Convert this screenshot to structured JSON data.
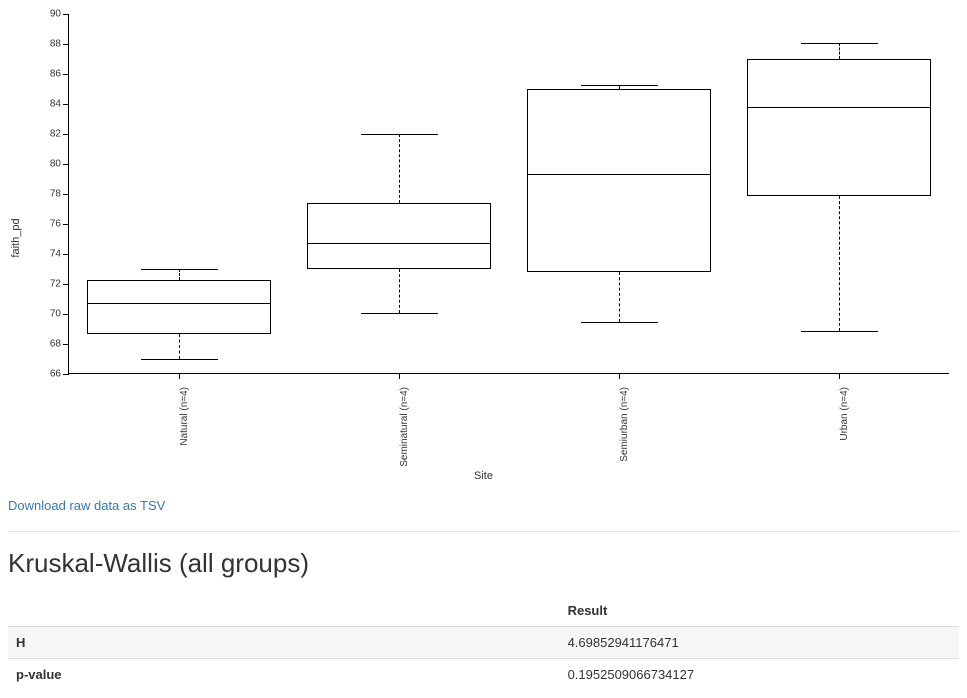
{
  "chart_data": {
    "type": "boxplot",
    "title": "",
    "xlabel": "Site",
    "ylabel": "faith_pd",
    "ylim": [
      66,
      90
    ],
    "yticks": [
      66,
      68,
      70,
      72,
      74,
      76,
      78,
      80,
      82,
      84,
      86,
      88,
      90
    ],
    "categories": [
      "Natural (n=4)",
      "Seminatural (n=4)",
      "Semiurban (n=4)",
      "Urban (n=4)"
    ],
    "series": [
      {
        "name": "Natural (n=4)",
        "min": 67.0,
        "q1": 68.7,
        "median": 70.8,
        "q3": 72.3,
        "max": 73.0
      },
      {
        "name": "Seminatural (n=4)",
        "min": 70.1,
        "q1": 73.0,
        "median": 74.8,
        "q3": 77.4,
        "max": 82.0
      },
      {
        "name": "Semiurban (n=4)",
        "min": 69.5,
        "q1": 72.8,
        "median": 79.4,
        "q3": 85.0,
        "max": 85.3
      },
      {
        "name": "Urban (n=4)",
        "min": 68.9,
        "q1": 77.9,
        "median": 83.9,
        "q3": 87.0,
        "max": 88.1
      }
    ]
  },
  "download_label": "Download raw data as TSV",
  "kruskal": {
    "heading": "Kruskal-Wallis (all groups)",
    "result_col": "Result",
    "rows": [
      {
        "label": "H",
        "value": "4.69852941176471"
      },
      {
        "label": "p-value",
        "value": "0.1952509066734127"
      }
    ]
  }
}
